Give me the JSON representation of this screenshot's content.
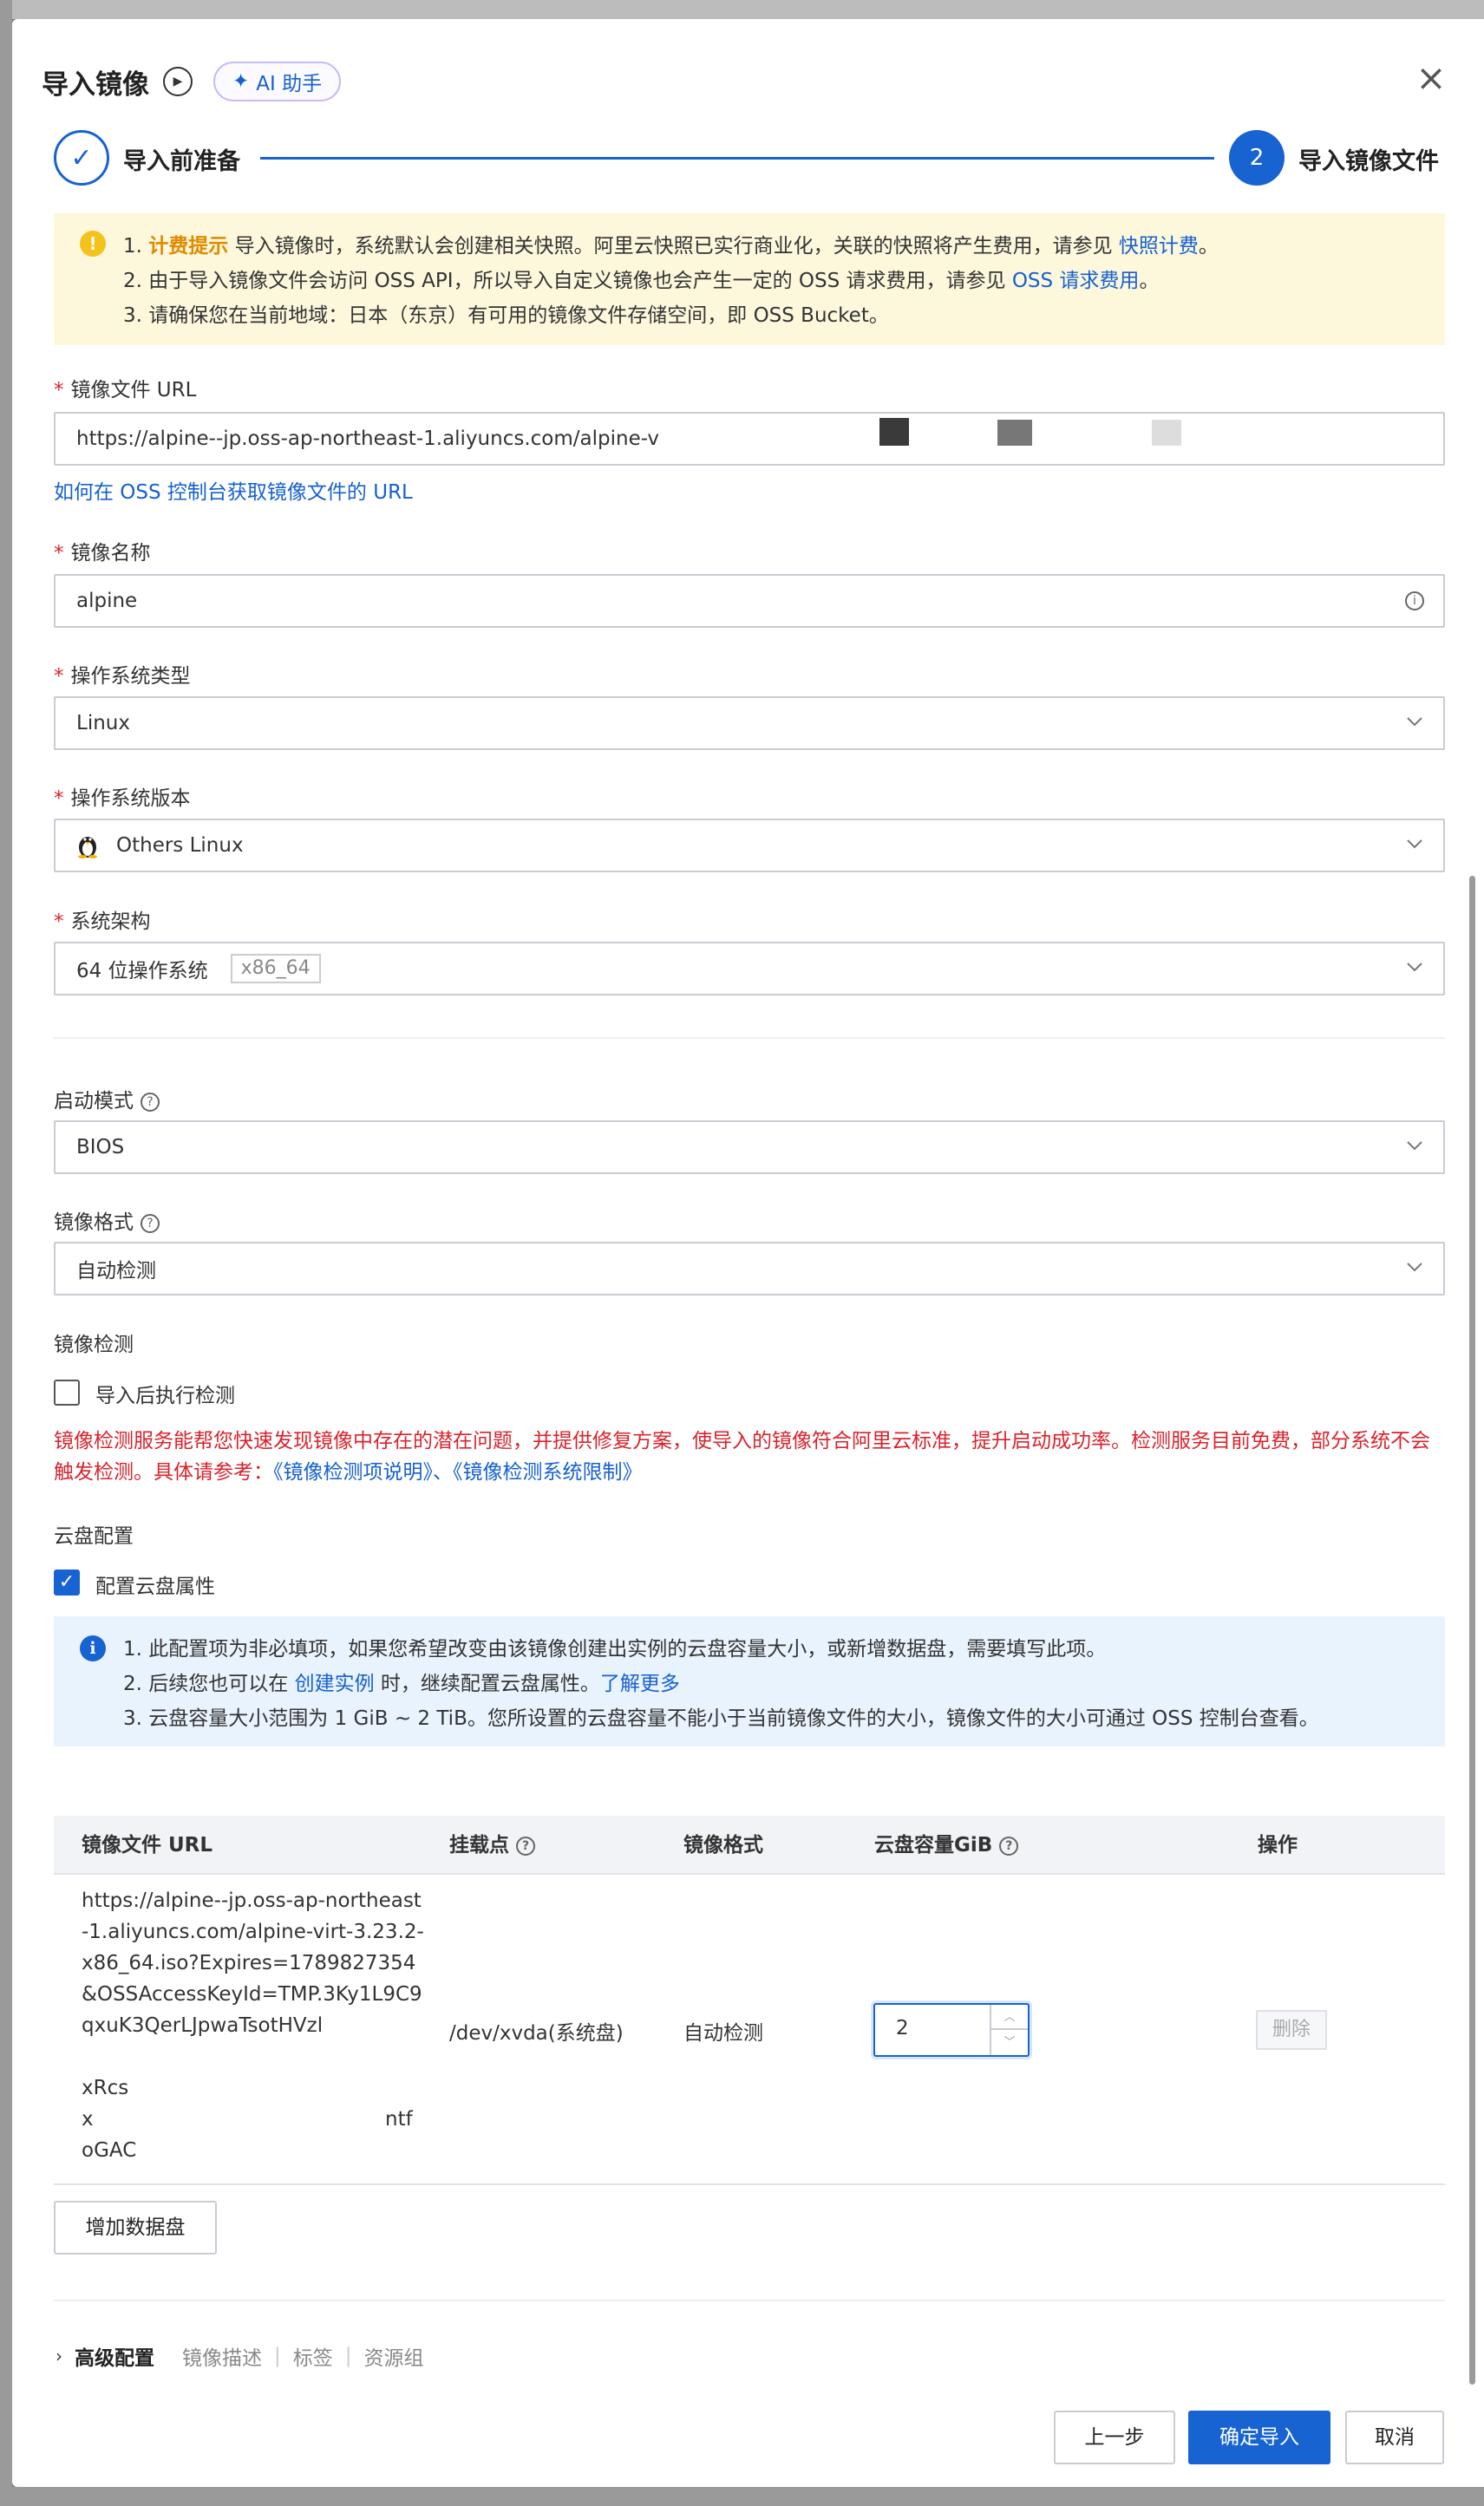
{
  "header": {
    "title": "导入镜像",
    "ai_label": "AI 助手"
  },
  "steps": {
    "step1_label": "导入前准备",
    "step2_num": "2",
    "step2_label": "导入镜像文件"
  },
  "warning": {
    "l1_prefix": "1.",
    "l1_bold": "计费提示",
    "l1_text": "导入镜像时，系统默认会创建相关快照。阿里云快照已实行商业化，关联的快照将产生费用，请参见",
    "l1_link": "快照计费",
    "l1_end": "。",
    "l2_text": "2. 由于导入镜像文件会访问 OSS API，所以导入自定义镜像也会产生一定的 OSS 请求费用，请参见",
    "l2_link": "OSS 请求费用",
    "l2_end": "。",
    "l3_text": "3. 请确保您在当前地域：日本（东京）有可用的镜像文件存储空间，即 OSS Bucket。"
  },
  "form": {
    "url_label": "镜像文件 URL",
    "url_value": "https://alpine--jp.oss-ap-northeast-1.aliyuncs.com/alpine-v",
    "url_help_link": "如何在 OSS 控制台获取镜像文件的 URL",
    "name_label": "镜像名称",
    "name_value": "alpine",
    "os_type_label": "操作系统类型",
    "os_type_value": "Linux",
    "os_version_label": "操作系统版本",
    "os_version_value": "Others Linux",
    "arch_label": "系统架构",
    "arch_value": "64 位操作系统",
    "arch_tag": "x86_64",
    "boot_label": "启动模式",
    "boot_value": "BIOS",
    "format_label": "镜像格式",
    "format_value": "自动检测",
    "check_label": "镜像检测",
    "check_option": "导入后执行检测",
    "check_desc": "镜像检测服务能帮您快速发现镜像中存在的潜在问题，并提供修复方案，使导入的镜像符合阿里云标准，提升启动成功率。检测服务目前免费，部分系统不会触发检测。具体请参考：",
    "check_desc_link": "《镜像检测项说明》、《镜像检测系统限制》",
    "disk_label": "云盘配置",
    "disk_option": "配置云盘属性"
  },
  "info": {
    "l1_text": "1. 此配置项为非必填项，如果您希望改变由该镜像创建出实例的云盘容量大小，或新增数据盘，需要填写此项。",
    "l2_text": "2. 后续您也可以在",
    "l2_link1": "创建实例",
    "l2_mid": "时，继续配置云盘属性。",
    "l2_link2": "了解更多",
    "l3_text": "3. 云盘容量大小范围为 1 GiB ~ 2 TiB。您所设置的云盘容量不能小于当前镜像文件的大小，镜像文件的大小可通过 OSS 控制台查看。"
  },
  "table": {
    "col_url": "镜像文件 URL",
    "col_mount": "挂载点",
    "col_format": "镜像格式",
    "col_size": "云盘容量GiB",
    "col_action": "操作",
    "row_url": "https://alpine--jp.oss-ap-northeast-1.aliyuncs.com/alpine-virt-3.23.2-x86_64.iso?Expires=1789827354&OSSAccessKeyId=TMP.3Ky1L9C9qxuK3QerLJpwaTsotHVzl",
    "row_url_tail1": "xRcs",
    "row_url_tail2": "x",
    "row_url_tail3": "ntf",
    "row_url_tail4": "oGAC",
    "row_mount": "/dev/xvda(系统盘)",
    "row_format": "自动检测",
    "row_size": "2",
    "row_delete": "删除",
    "add_disk": "增加数据盘"
  },
  "advanced": {
    "title": "高级配置",
    "items": [
      "镜像描述",
      "标签",
      "资源组"
    ]
  },
  "footer": {
    "prev": "上一步",
    "confirm": "确定导入",
    "cancel": "取消"
  },
  "colors": {
    "accent": "#1763d2",
    "warning_bg": "#fdf8dc",
    "info_bg": "#e9f3fd",
    "error": "#d9232c"
  }
}
